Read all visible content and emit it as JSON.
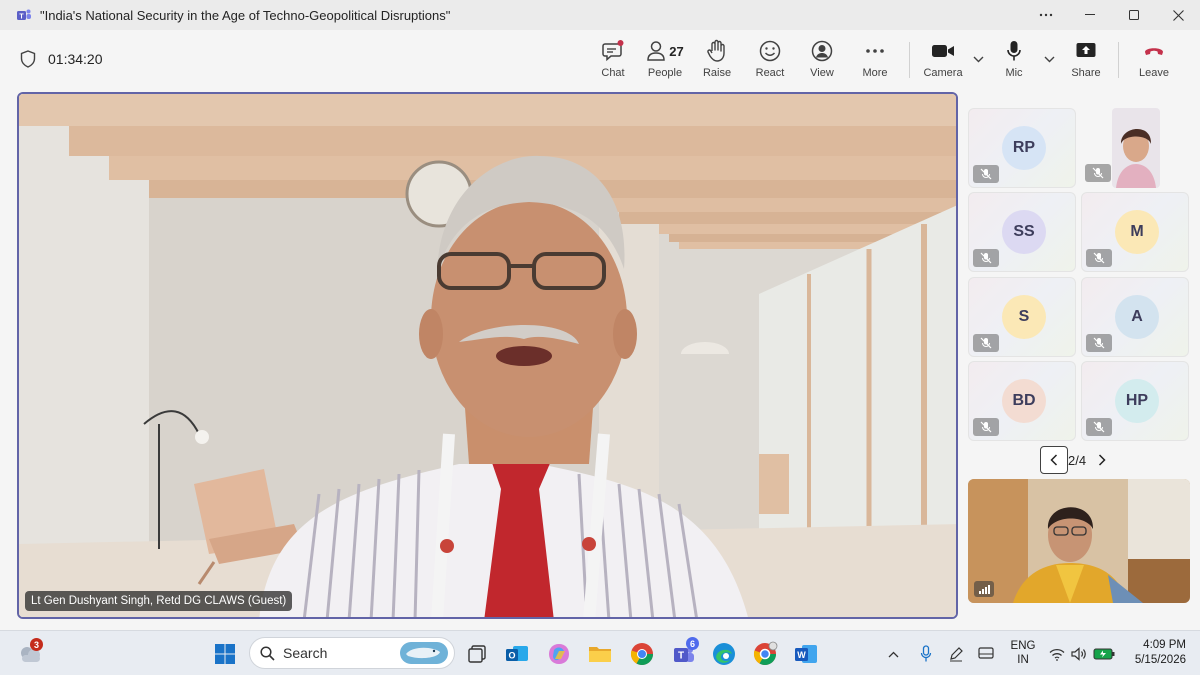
{
  "window": {
    "title": "\"India's National Security in the Age of Techno-Geopolitical Disruptions\"",
    "controls": [
      "more-options",
      "minimize",
      "maximize",
      "close"
    ]
  },
  "meeting": {
    "timer": "01:34:20",
    "toolbar": {
      "chat": "Chat",
      "people": "People",
      "people_count": "27",
      "raise": "Raise",
      "react": "React",
      "view": "View",
      "more": "More",
      "camera": "Camera",
      "mic": "Mic",
      "share": "Share",
      "leave": "Leave"
    },
    "colors": {
      "accent": "#6264a7",
      "leave": "#c4314b",
      "chat_dot": "#c4314b"
    }
  },
  "main_video": {
    "speaker_name": "Lt Gen Dushyant Singh, Retd DG CLAWS (Guest)"
  },
  "gallery": {
    "participants": [
      {
        "initials": "RP",
        "color": "#d6e4f5",
        "muted": true
      },
      {
        "initials": "",
        "photo": true,
        "muted": true
      },
      {
        "initials": "SS",
        "color": "#dcd9f2",
        "muted": true
      },
      {
        "initials": "M",
        "color": "#fbe8b6",
        "muted": true
      },
      {
        "initials": "S",
        "color": "#fbe8b6",
        "muted": true
      },
      {
        "initials": "A",
        "color": "#d3e3ef",
        "muted": true
      },
      {
        "initials": "BD",
        "color": "#f3dcd2",
        "muted": true
      },
      {
        "initials": "HP",
        "color": "#d3ecee",
        "muted": true
      }
    ],
    "pager": "2/4"
  },
  "taskbar": {
    "weather_badge": "3",
    "search_placeholder": "Search",
    "teams_badge": "6",
    "language": "ENG",
    "region": "IN",
    "time": "4:09 PM",
    "date": "5/15/2026"
  }
}
